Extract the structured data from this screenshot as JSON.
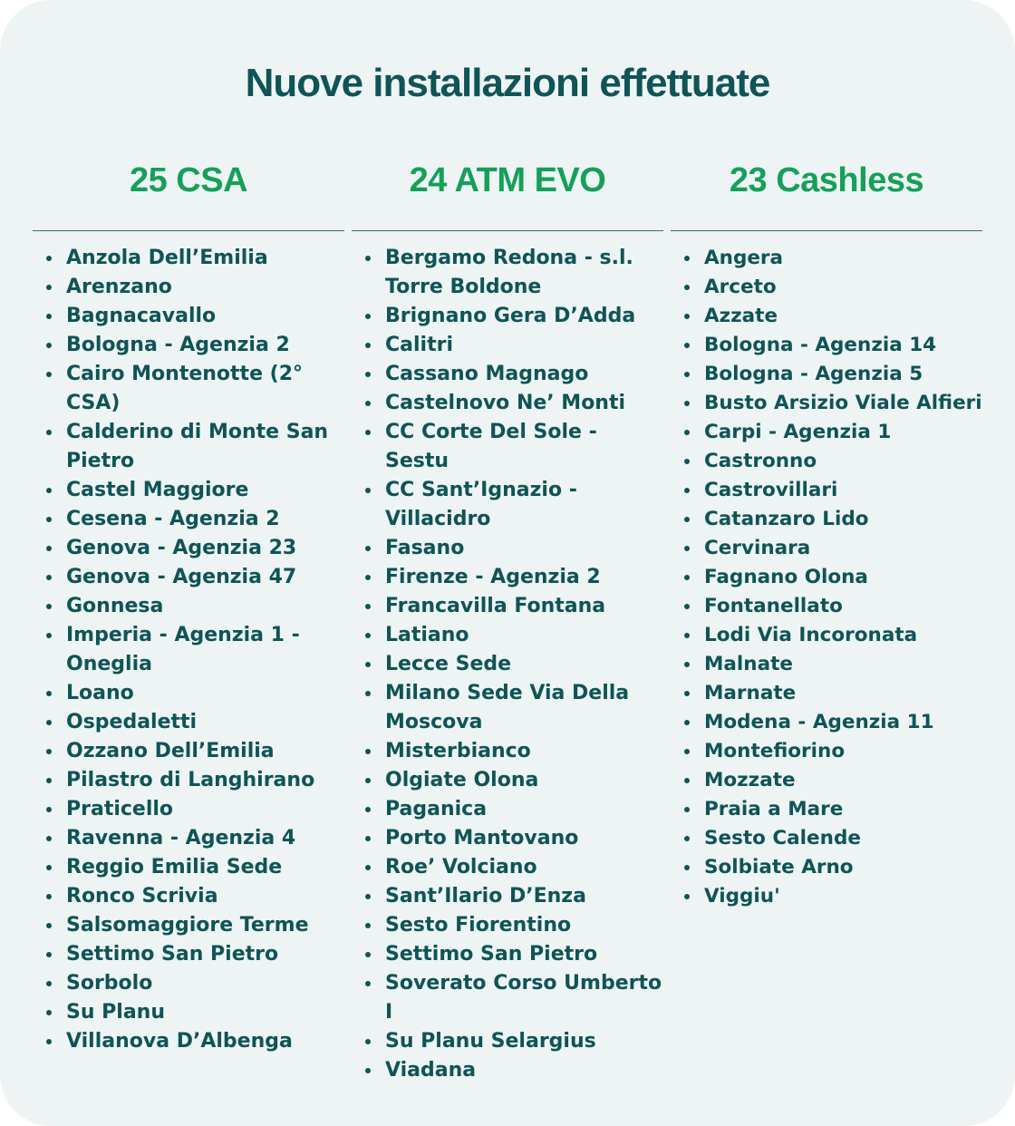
{
  "title": "Nuove installazioni effettuate",
  "columns": [
    {
      "heading": "25 CSA",
      "items": [
        "Anzola Dell’Emilia",
        "Arenzano",
        "Bagnacavallo",
        "Bologna - Agenzia 2",
        "Cairo Montenotte (2° CSA)",
        "Calderino di Monte San Pietro",
        "Castel Maggiore",
        "Cesena - Agenzia 2",
        "Genova - Agenzia 23",
        "Genova - Agenzia 47",
        "Gonnesa",
        "Imperia - Agenzia 1 - Oneglia",
        "Loano",
        "Ospedaletti",
        "Ozzano Dell’Emilia",
        "Pilastro di Langhirano",
        "Praticello",
        "Ravenna - Agenzia 4",
        "Reggio Emilia Sede",
        "Ronco Scrivia",
        "Salsomaggiore Terme",
        "Settimo San Pietro",
        "Sorbolo",
        "Su Planu",
        "Villanova D’Albenga"
      ]
    },
    {
      "heading": "24 ATM EVO",
      "items": [
        "Bergamo Redona - s.l. Torre Boldone",
        "Brignano Gera D’Adda",
        "Calitri",
        "Cassano Magnago",
        "Castelnovo Ne’ Monti",
        "CC Corte Del Sole - Sestu",
        "CC Sant’Ignazio - Villacidro",
        "Fasano",
        "Firenze - Agenzia 2",
        "Francavilla Fontana",
        "Latiano",
        "Lecce Sede",
        "Milano Sede Via Della Moscova",
        "Misterbianco",
        "Olgiate Olona",
        "Paganica",
        "Porto Mantovano",
        "Roe’ Volciano",
        "Sant’Ilario D’Enza",
        "Sesto Fiorentino",
        "Settimo San Pietro",
        "Soverato Corso Umberto I",
        "Su Planu Selargius",
        "Viadana"
      ]
    },
    {
      "heading": "23 Cashless",
      "items": [
        "Angera",
        "Arceto",
        "Azzate",
        "Bologna - Agenzia 14",
        "Bologna - Agenzia 5",
        "Busto Arsizio Viale Alfieri",
        "Carpi - Agenzia 1",
        "Castronno",
        "Castrovillari",
        "Catanzaro Lido",
        "Cervinara",
        "Fagnano Olona",
        "Fontanellato",
        "Lodi Via Incoronata",
        "Malnate",
        "Marnate",
        "Modena - Agenzia 11",
        "Montefiorino",
        "Mozzate",
        "Praia a Mare",
        "Sesto Calende",
        "Solbiate Arno",
        "Viggiu'"
      ]
    }
  ]
}
